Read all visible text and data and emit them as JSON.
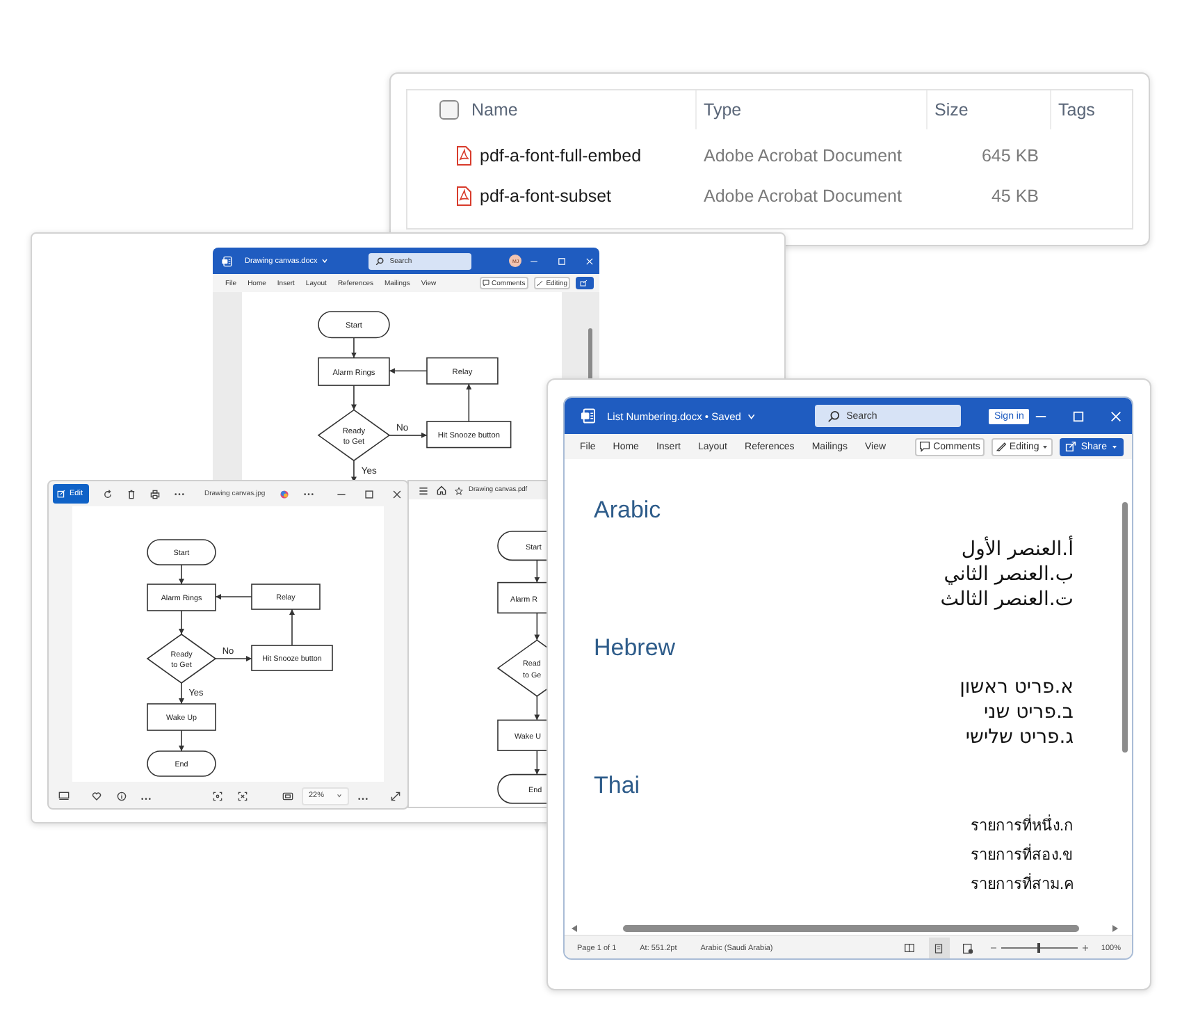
{
  "explorer": {
    "header_checkbox": {
      "checked": false
    },
    "columns": [
      {
        "label": "Name"
      },
      {
        "label": "Type"
      },
      {
        "label": "Size"
      },
      {
        "label": "Tags"
      }
    ],
    "rows": [
      {
        "name": "pdf-a-font-full-embed",
        "type": "Adobe Acrobat Document",
        "size": "645 KB"
      },
      {
        "name": "pdf-a-font-subset",
        "type": "Adobe Acrobat Document",
        "size": "45 KB"
      }
    ]
  },
  "word_small": {
    "title": "Drawing canvas.docx",
    "search_placeholder": "Search",
    "avatar": "MJ",
    "menu": [
      "File",
      "Home",
      "Insert",
      "Layout",
      "References",
      "Mailings",
      "View"
    ],
    "comments": "Comments",
    "editing": "Editing",
    "flowchart": [
      {
        "kind": "terminal",
        "text": "Start"
      },
      {
        "kind": "process",
        "text": "Alarm Rings"
      },
      {
        "kind": "process",
        "text": "Relay"
      },
      {
        "kind": "decision",
        "lines": [
          "Ready",
          "to Get"
        ]
      },
      {
        "kind": "label",
        "text": "No"
      },
      {
        "kind": "process",
        "text": "Hit Snooze button"
      },
      {
        "kind": "label",
        "text": "Yes"
      }
    ]
  },
  "photos_viewer": {
    "edit": "Edit",
    "title": "Drawing canvas.jpg",
    "zoom": "22%",
    "flowchart": [
      {
        "kind": "terminal",
        "text": "Start"
      },
      {
        "kind": "process",
        "text": "Alarm Rings"
      },
      {
        "kind": "process",
        "text": "Relay"
      },
      {
        "kind": "decision",
        "lines": [
          "Ready",
          "to Get"
        ]
      },
      {
        "kind": "label",
        "text": "No"
      },
      {
        "kind": "process",
        "text": "Hit Snooze button"
      },
      {
        "kind": "label",
        "text": "Yes"
      },
      {
        "kind": "process",
        "text": "Wake Up"
      },
      {
        "kind": "terminal",
        "text": "End"
      }
    ]
  },
  "pdf_viewer": {
    "title": "Drawing canvas.pdf",
    "flowchart": [
      {
        "kind": "terminal",
        "text": "Start"
      },
      {
        "kind": "process",
        "text": "Alarm R"
      },
      {
        "kind": "decision",
        "lines": [
          "Read",
          "to Ge"
        ]
      },
      {
        "kind": "process",
        "text": "Wake U"
      },
      {
        "kind": "terminal",
        "text": "End"
      }
    ]
  },
  "word_main": {
    "title": "List Numbering.docx • Saved",
    "search_placeholder": "Search",
    "sign_in": "Sign in",
    "menu": [
      "File",
      "Home",
      "Insert",
      "Layout",
      "References",
      "Mailings",
      "View"
    ],
    "comments": "Comments",
    "editing": "Editing",
    "share": "Share",
    "sections": [
      {
        "heading": "Arabic",
        "kind": "rtl",
        "items": [
          "أ.العنصر الأول",
          "ب.العنصر الثاني",
          "ت.العنصر الثالث"
        ]
      },
      {
        "heading": "Hebrew",
        "kind": "rtl",
        "items": [
          "א.פריט ראשון",
          "ב.פריט שני",
          "ג.פריט שלישי"
        ]
      },
      {
        "heading": "Thai",
        "kind": "ltr",
        "items": [
          "รายการที่หนึ่ง.ก",
          "รายการที่สอง.ข",
          "รายการที่สาม.ค"
        ]
      }
    ],
    "status_bar": {
      "page": "Page 1 of 1",
      "position": "At: 551.2pt",
      "language": "Arabic (Saudi Arabia)",
      "views": [
        {
          "kind": "read",
          "selected": false
        },
        {
          "kind": "print",
          "selected": true
        },
        {
          "kind": "web",
          "selected": false
        }
      ],
      "zoom_slider": {
        "level": 0.5
      },
      "zoom": "100%"
    }
  }
}
